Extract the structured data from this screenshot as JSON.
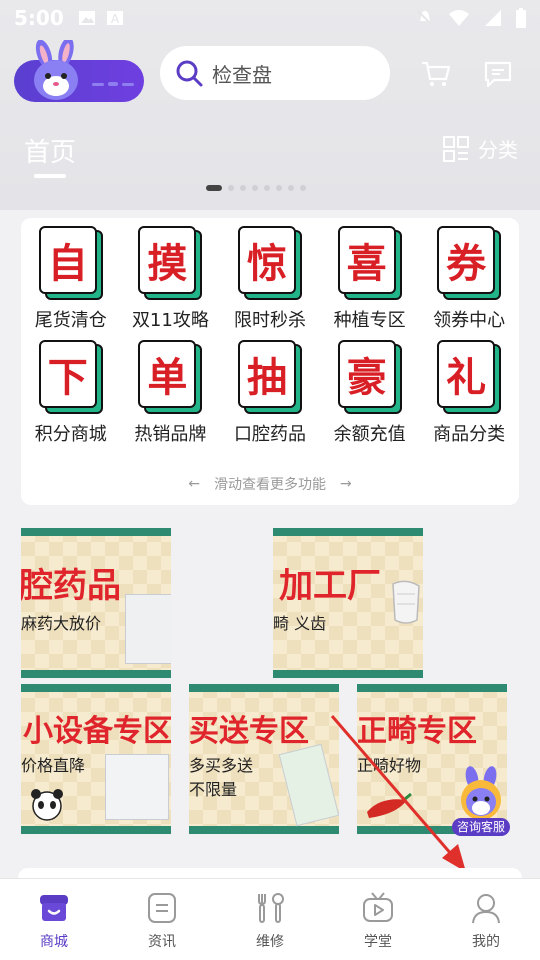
{
  "status_bar": {
    "time": "5:00"
  },
  "search": {
    "placeholder": "检查盘"
  },
  "top_nav": {
    "home_tab": "首页",
    "category_label": "分类"
  },
  "carousel": {
    "total_dots": 8,
    "active_index": 0
  },
  "functions": [
    {
      "char": "自",
      "label": "尾货清仓"
    },
    {
      "char": "摸",
      "label": "双11攻略"
    },
    {
      "char": "惊",
      "label": "限时秒杀"
    },
    {
      "char": "喜",
      "label": "种植专区"
    },
    {
      "char": "券",
      "label": "领券中心"
    },
    {
      "char": "下",
      "label": "积分商城"
    },
    {
      "char": "单",
      "label": "热销品牌"
    },
    {
      "char": "抽",
      "label": "口腔药品"
    },
    {
      "char": "豪",
      "label": "余额充值"
    },
    {
      "char": "礼",
      "label": "商品分类"
    }
  ],
  "scroll_hint": "滑动查看更多功能",
  "banners": [
    {
      "title": "腔药品",
      "subtitle": "麻药大放价"
    },
    {
      "title": "加工厂",
      "subtitle": "畸  义齿"
    },
    {
      "title": "小设备专区",
      "subtitle": "价格直降"
    },
    {
      "title": "买送专区",
      "subtitle": "多买多送",
      "subtitle2": "不限量"
    },
    {
      "title": "正畸专区",
      "subtitle": "正畸好物"
    }
  ],
  "customer_service": {
    "label": "咨询客服"
  },
  "tabbar": [
    {
      "label": "商城",
      "active": true
    },
    {
      "label": "资讯",
      "active": false
    },
    {
      "label": "维修",
      "active": false
    },
    {
      "label": "学堂",
      "active": false
    },
    {
      "label": "我的",
      "active": false
    }
  ],
  "colors": {
    "brand": "#5b3cc4",
    "accent_red": "#e0242b",
    "teal": "#2f8a72"
  }
}
